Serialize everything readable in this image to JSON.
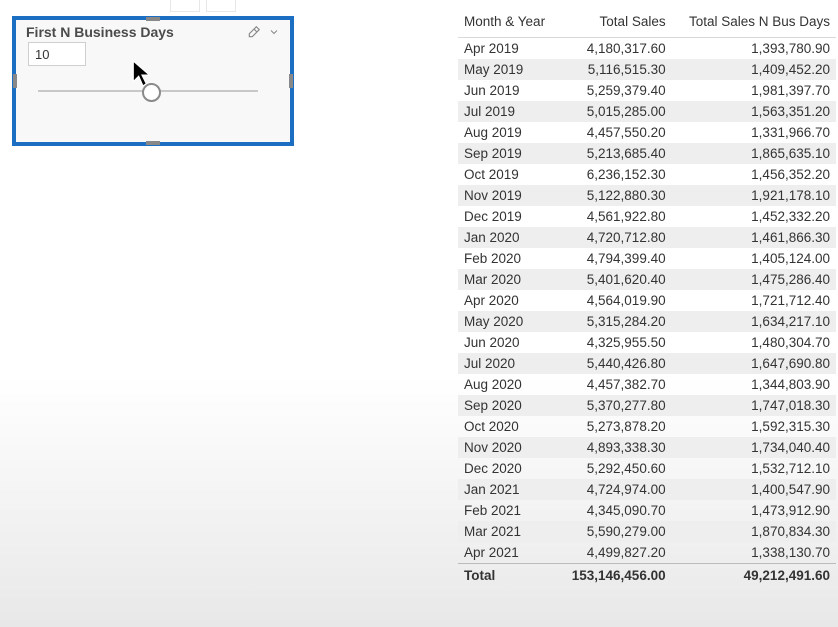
{
  "slicer": {
    "title": "First N Business Days",
    "value": "10"
  },
  "table": {
    "headers": {
      "month": "Month & Year",
      "sales": "Total Sales",
      "busdays": "Total Sales N Bus Days"
    },
    "total_label": "Total",
    "total_sales": "153,146,456.00",
    "total_bus": "49,212,491.60",
    "rows": [
      {
        "m": "Apr 2019",
        "s": "4,180,317.60",
        "b": "1,393,780.90"
      },
      {
        "m": "May 2019",
        "s": "5,116,515.30",
        "b": "1,409,452.20"
      },
      {
        "m": "Jun 2019",
        "s": "5,259,379.40",
        "b": "1,981,397.70"
      },
      {
        "m": "Jul 2019",
        "s": "5,015,285.00",
        "b": "1,563,351.20"
      },
      {
        "m": "Aug 2019",
        "s": "4,457,550.20",
        "b": "1,331,966.70"
      },
      {
        "m": "Sep 2019",
        "s": "5,213,685.40",
        "b": "1,865,635.10"
      },
      {
        "m": "Oct 2019",
        "s": "6,236,152.30",
        "b": "1,456,352.20"
      },
      {
        "m": "Nov 2019",
        "s": "5,122,880.30",
        "b": "1,921,178.10"
      },
      {
        "m": "Dec 2019",
        "s": "4,561,922.80",
        "b": "1,452,332.20"
      },
      {
        "m": "Jan 2020",
        "s": "4,720,712.80",
        "b": "1,461,866.30"
      },
      {
        "m": "Feb 2020",
        "s": "4,794,399.40",
        "b": "1,405,124.00"
      },
      {
        "m": "Mar 2020",
        "s": "5,401,620.40",
        "b": "1,475,286.40"
      },
      {
        "m": "Apr 2020",
        "s": "4,564,019.90",
        "b": "1,721,712.40"
      },
      {
        "m": "May 2020",
        "s": "5,315,284.20",
        "b": "1,634,217.10"
      },
      {
        "m": "Jun 2020",
        "s": "4,325,955.50",
        "b": "1,480,304.70"
      },
      {
        "m": "Jul 2020",
        "s": "5,440,426.80",
        "b": "1,647,690.80"
      },
      {
        "m": "Aug 2020",
        "s": "4,457,382.70",
        "b": "1,344,803.90"
      },
      {
        "m": "Sep 2020",
        "s": "5,370,277.80",
        "b": "1,747,018.30"
      },
      {
        "m": "Oct 2020",
        "s": "5,273,878.20",
        "b": "1,592,315.30"
      },
      {
        "m": "Nov 2020",
        "s": "4,893,338.30",
        "b": "1,734,040.40"
      },
      {
        "m": "Dec 2020",
        "s": "5,292,450.60",
        "b": "1,532,712.10"
      },
      {
        "m": "Jan 2021",
        "s": "4,724,974.00",
        "b": "1,400,547.90"
      },
      {
        "m": "Feb 2021",
        "s": "4,345,090.70",
        "b": "1,473,912.90"
      },
      {
        "m": "Mar 2021",
        "s": "5,590,279.00",
        "b": "1,870,834.30"
      },
      {
        "m": "Apr 2021",
        "s": "4,499,827.20",
        "b": "1,338,130.70"
      }
    ]
  }
}
